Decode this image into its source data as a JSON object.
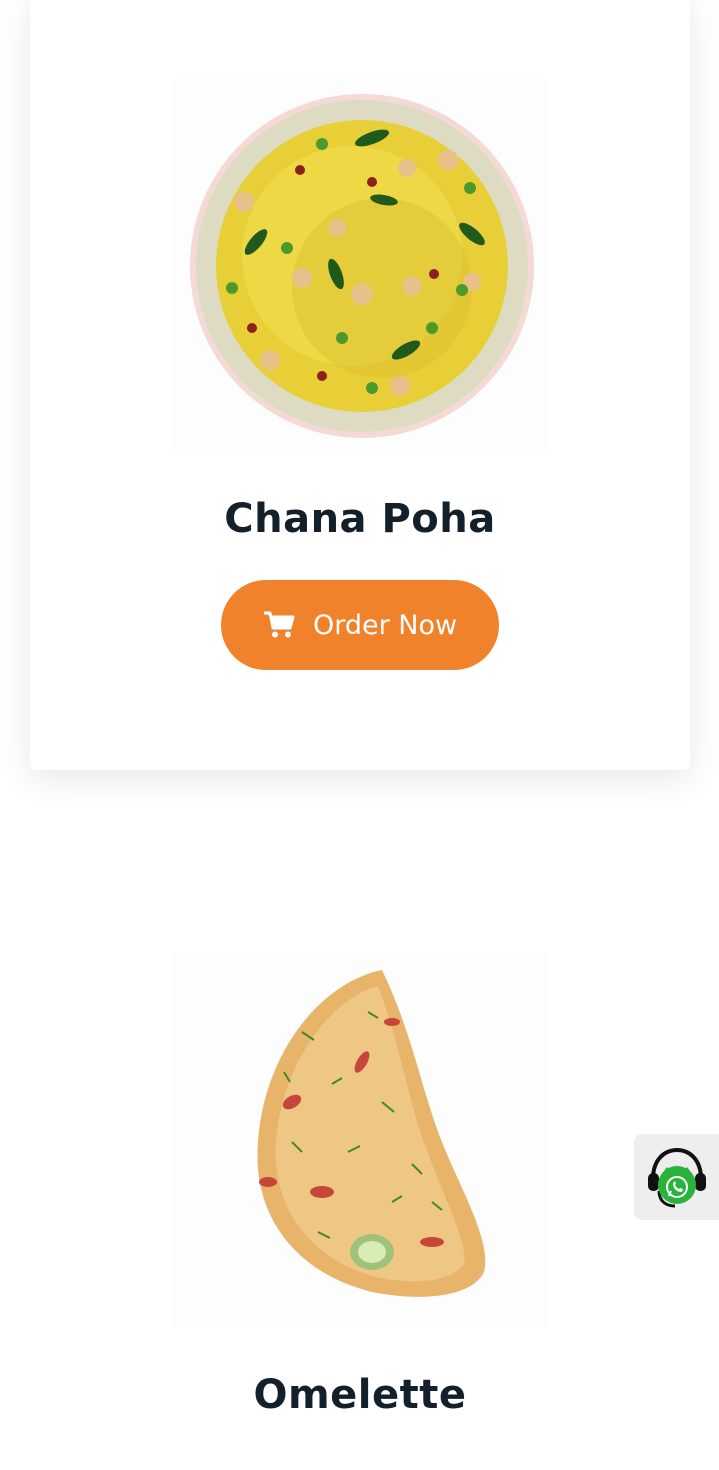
{
  "products": [
    {
      "name": "Chana Poha",
      "button_label": "Order Now",
      "icon": "cart-icon"
    },
    {
      "name": "Omelette"
    }
  ],
  "widget": {
    "icon": "whatsapp-support-icon"
  },
  "colors": {
    "accent": "#f0822c",
    "title": "#13202b",
    "whatsapp": "#25d366"
  }
}
